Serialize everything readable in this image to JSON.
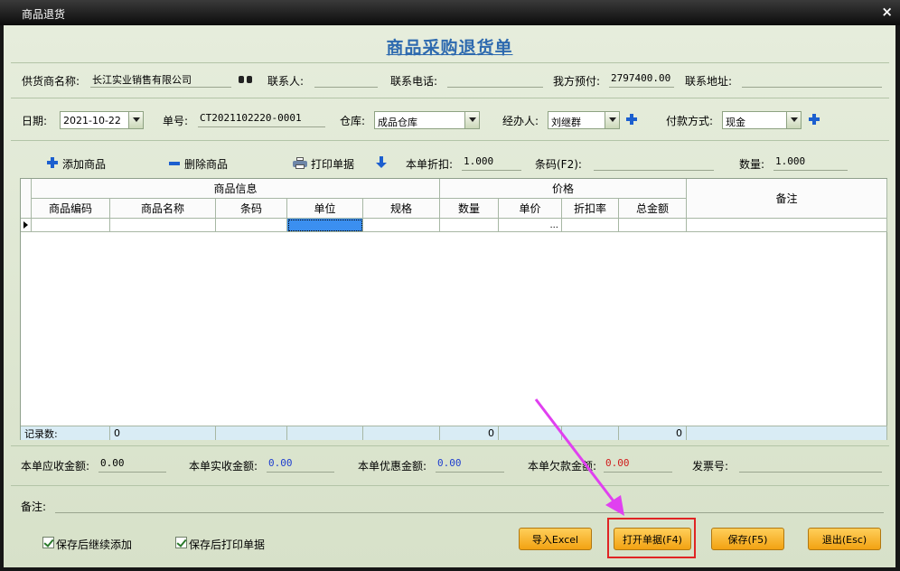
{
  "window": {
    "title": "商品退货",
    "close_glyph": "×"
  },
  "doc_title": "商品采购退货单",
  "row1": {
    "supplier_label": "供货商名称:",
    "supplier_value": "长江实业销售有限公司",
    "contact_label": "联系人:",
    "contact_value": "",
    "phone_label": "联系电话:",
    "phone_value": "",
    "prepay_label": "我方预付:",
    "prepay_value": "2797400.00",
    "address_label": "联系地址:",
    "address_value": ""
  },
  "row2": {
    "date_label": "日期:",
    "date_value": "2021-10-22",
    "no_label": "单号:",
    "no_value": "CT2021102220-0001",
    "warehouse_label": "仓库:",
    "warehouse_value": "成品仓库",
    "handler_label": "经办人:",
    "handler_value": "刘继群",
    "pay_label": "付款方式:",
    "pay_value": "现金"
  },
  "toolbar": {
    "add_label": "添加商品",
    "delete_label": "删除商品",
    "print_label": "打印单据",
    "discount_label": "本单折扣:",
    "discount_value": "1.000",
    "barcode_label": "条码(F2):",
    "barcode_value": "",
    "qty_label": "数量:",
    "qty_value": "1.000"
  },
  "grid": {
    "group_goods": "商品信息",
    "group_price": "价格",
    "note_header": "备注",
    "columns": [
      "商品编码",
      "商品名称",
      "条码",
      "单位",
      "规格",
      "数量",
      "单价",
      "折扣率",
      "总金额"
    ],
    "ellipsis": "...",
    "footer_label": "记录数:",
    "footer_count": "0",
    "footer_qty": "0",
    "footer_amount": "0"
  },
  "totals": {
    "receivable_label": "本单应收金额:",
    "receivable_value": "0.00",
    "received_label": "本单实收金额:",
    "received_value": "0.00",
    "discount_label": "本单优惠金额:",
    "discount_value": "0.00",
    "owed_label": "本单欠款金额:",
    "owed_value": "0.00",
    "invoice_label": "发票号:",
    "invoice_value": ""
  },
  "remark_label": "备注:",
  "options": {
    "continue_add": "保存后继续添加",
    "print_after": "保存后打印单据"
  },
  "buttons": {
    "import": "导入Excel",
    "open": "打开单据(F4)",
    "save": "保存(F5)",
    "exit": "退出(Esc)"
  },
  "colors": {
    "accent_title": "#2e6aaf",
    "button": "#f5b12a",
    "highlight": "#e02424",
    "annotation_arrow": "#e040f0"
  }
}
